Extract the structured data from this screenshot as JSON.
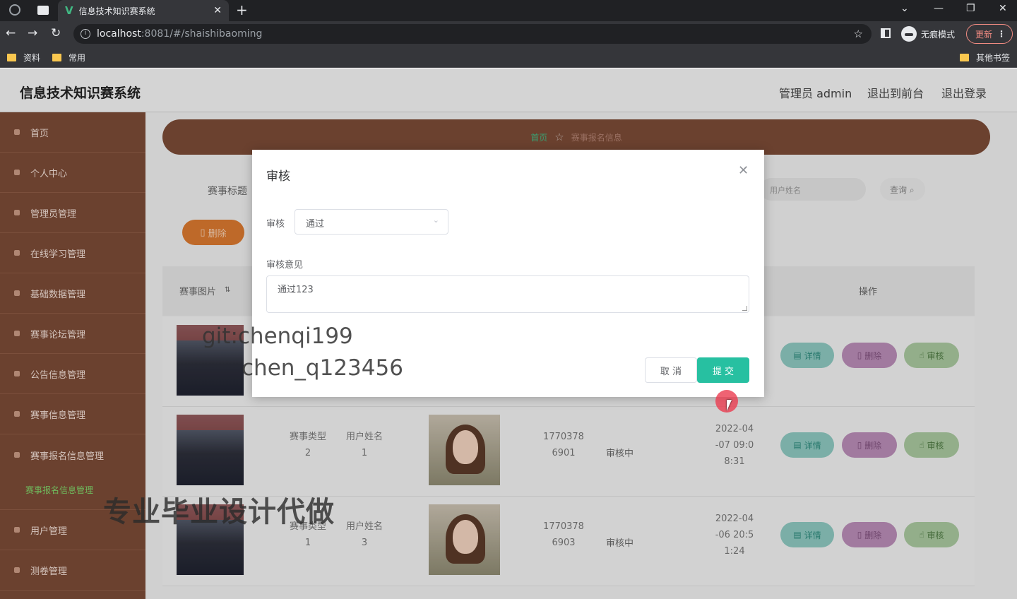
{
  "browser": {
    "tab_title": "信息技术知识赛系统",
    "url_host": "localhost",
    "url_path": ":8081/#/shaishibaoming",
    "incognito_label": "无痕模式",
    "update_label": "更新",
    "bookmarks": [
      "资料",
      "常用"
    ],
    "other_bookmarks": "其他书签"
  },
  "header": {
    "title": "信息技术知识赛系统",
    "admin_link": "管理员 admin",
    "frontend_link": "退出到前台",
    "logout_link": "退出登录"
  },
  "sidebar": {
    "items": [
      "首页",
      "个人中心",
      "管理员管理",
      "在线学习管理",
      "基础数据管理",
      "赛事论坛管理",
      "公告信息管理",
      "赛事信息管理",
      "赛事报名信息管理",
      "用户管理",
      "测卷管理"
    ],
    "sub_item": "赛事报名信息管理"
  },
  "main": {
    "breadcrumb_home": "首页",
    "breadcrumb_current": "赛事报名信息",
    "filter_label": "赛事标题",
    "filter_placeholder": "用户姓名",
    "search_label": "查询",
    "batch_delete": "删除",
    "columns": [
      "赛事图片",
      "操作"
    ],
    "rows": [
      {
        "type": "赛事类型 2",
        "user": "用户姓名 1",
        "phone": "1770378 6901",
        "status": "审核中",
        "time": "2022-04 -07 09:0 8:31"
      },
      {
        "type": "赛事类型 1",
        "user": "用户姓名 3",
        "phone": "1770378 6903",
        "status": "审核中",
        "time": "2022-04 -06 20:5 1:24"
      }
    ],
    "actions": {
      "detail": "详情",
      "delete": "删除",
      "review": "审核"
    }
  },
  "modal": {
    "title": "审核",
    "review_label": "审核",
    "review_value": "通过",
    "opinion_label": "审核意见",
    "opinion_value": "通过123",
    "cancel": "取 消",
    "submit": "提 交"
  },
  "watermarks": [
    "git:chenqi199",
    "chen_q123456",
    "专业毕业设计代做"
  ]
}
